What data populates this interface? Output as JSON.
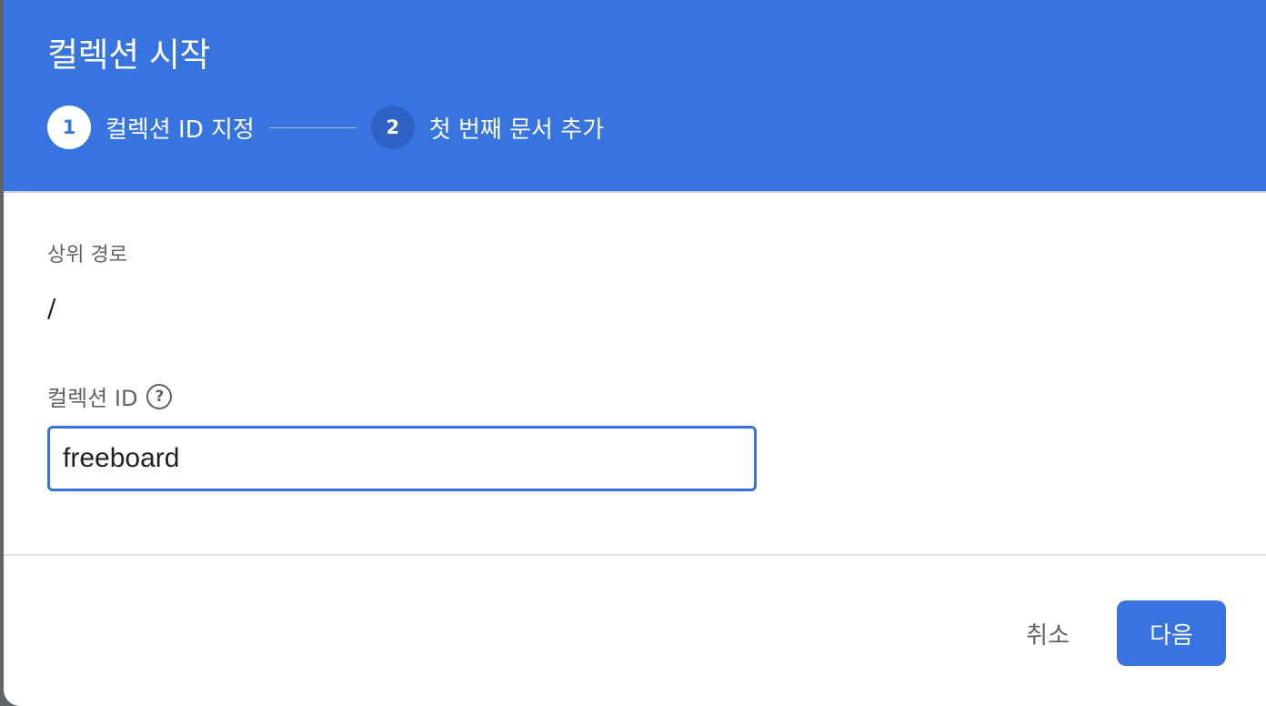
{
  "dialog": {
    "title": "컬렉션 시작",
    "steps": [
      {
        "number": "1",
        "label": "컬렉션 ID 지정",
        "state": "active"
      },
      {
        "number": "2",
        "label": "첫 번째 문서 추가",
        "state": "inactive"
      }
    ]
  },
  "form": {
    "parent_path_label": "상위 경로",
    "parent_path_value": "/",
    "collection_id_label": "컬렉션 ID",
    "help_icon_glyph": "?",
    "collection_id_value": "freeboard"
  },
  "footer": {
    "cancel_label": "취소",
    "next_label": "다음"
  },
  "colors": {
    "accent": "#3874e0",
    "text_secondary": "#5f6368"
  }
}
